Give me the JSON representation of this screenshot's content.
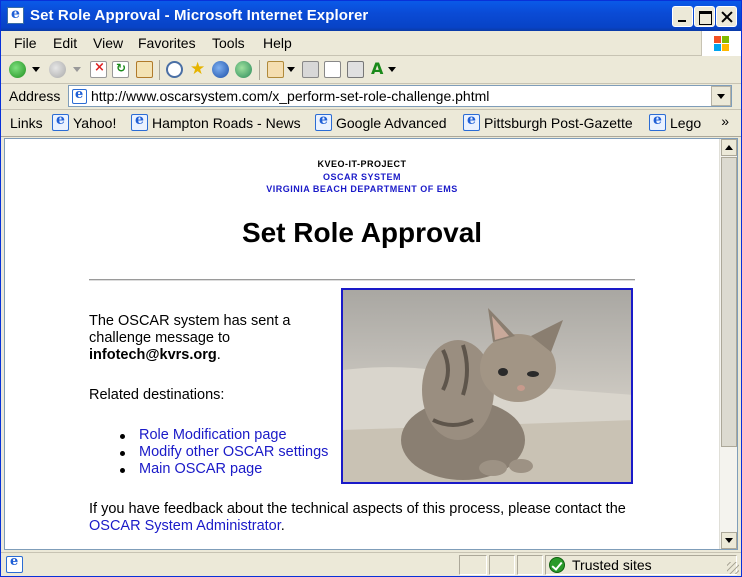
{
  "window": {
    "title": "Set Role Approval - Microsoft Internet Explorer"
  },
  "menu": {
    "file": "File",
    "edit": "Edit",
    "view": "View",
    "favorites": "Favorites",
    "tools": "Tools",
    "help": "Help"
  },
  "toolbar": {
    "icons": [
      "back-icon",
      "forward-icon",
      "stop-icon",
      "refresh-icon",
      "home-icon",
      "search-icon",
      "favorites-star-icon",
      "media-icon",
      "history-icon",
      "mail-icon",
      "print-icon",
      "edit-icon",
      "discuss-icon",
      "messenger-icon"
    ]
  },
  "address": {
    "label": "Address",
    "url": "http://www.oscarsystem.com/x_perform-set-role-challenge.phtml"
  },
  "links": {
    "label": "Links",
    "items": [
      "Yahoo!",
      "Hampton Roads - News",
      "Google Advanced",
      "Pittsburgh Post-Gazette",
      "Lego"
    ],
    "more": "»"
  },
  "page": {
    "header": {
      "project": "KVEO-IT-PROJECT",
      "system": "OSCAR SYSTEM",
      "department": "VIRGINIA BEACH DEPARTMENT OF EMS"
    },
    "title": "Set Role Approval",
    "message_prefix": "The OSCAR system has sent a challenge message to",
    "email": "infotech@kvrs.org",
    "message_suffix": ".",
    "related_label": "Related destinations:",
    "related_links": [
      "Role Modification page",
      "Modify other OSCAR settings",
      "Main OSCAR page"
    ],
    "feedback_text": "If you have feedback about the technical aspects of this process, please contact the",
    "feedback_link": "OSCAR System Administrator",
    "feedback_end": "."
  },
  "status": {
    "zone": "Trusted sites"
  },
  "colors": {
    "title_bar": "#0a4bd6",
    "link": "#1a1ac8",
    "window_bg": "#ece9d8"
  }
}
